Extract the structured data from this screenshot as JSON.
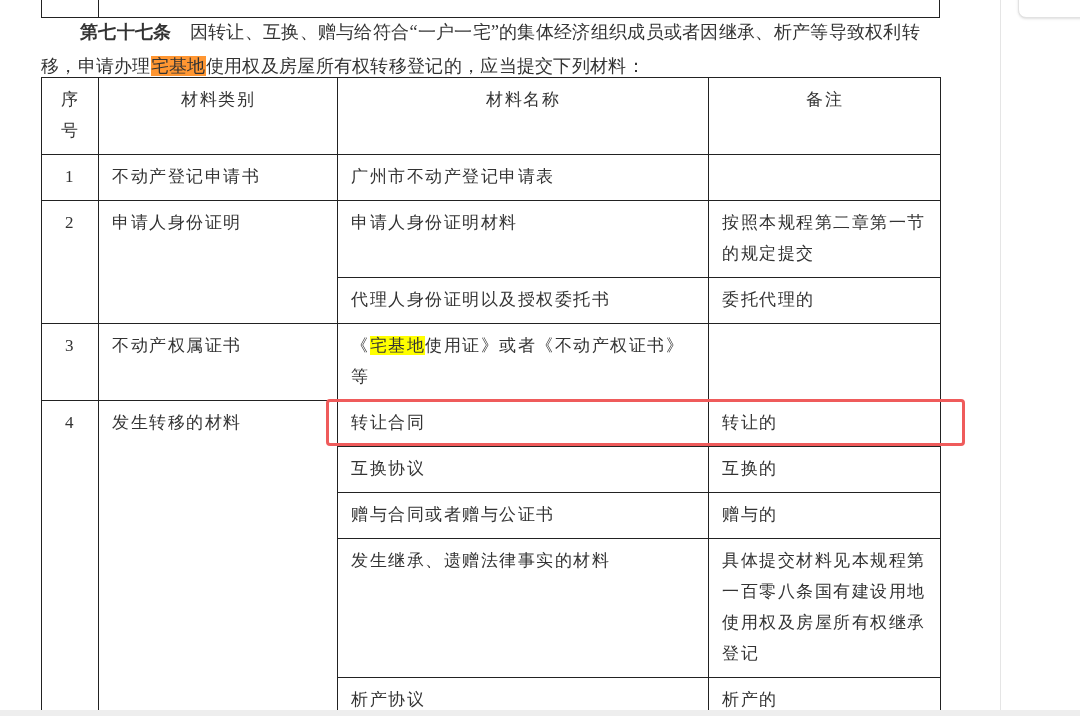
{
  "document": {
    "paragraph": [
      {
        "text": "**第七十七条**　因转让、互换、赠与给符合“一户一宅”的集体经济组织成员或者因继承、析产等导致权利转移，申请办理"
      },
      {
        "text": "宅基地",
        "color": "#ff9632"
      },
      {
        "text": "使用权及房屋所有权转移登记的，应当提交下列材料："
      }
    ]
  },
  "table": {
    "columns": [
      "序号",
      "材料类别",
      "材料名称",
      "备注"
    ],
    "groups": [
      {
        "number": "1",
        "category": "不动产登记申请书",
        "items": [
          {
            "name": [
              {
                "text": "广州市不动产登记申请表"
              }
            ],
            "highlighted": false
          }
        ]
      },
      {
        "number": "2",
        "category": "申请人身份证明",
        "items": [
          {
            "name": [
              {
                "text": "申请人身份证明材料"
              }
            ],
            "note": "按照本规程第二章第一节的规定提交",
            "highlighted": false
          },
          {
            "name": [
              {
                "text": "代理人身份证明以及授权委托书"
              }
            ],
            "note": "委托代理的",
            "highlighted": false
          }
        ]
      },
      {
        "number": "3",
        "category": "不动产权属证书",
        "items": [
          {
            "name": [
              {
                "text": "《"
              },
              {
                "text": "宅基地",
                "color": "#ffff00"
              },
              {
                "text": "使用证》或者《不动产权证书》等"
              }
            ],
            "highlighted": false
          }
        ]
      },
      {
        "number": "4",
        "category": "发生转移的材料",
        "items": [
          {
            "name": [
              {
                "text": "转让合同"
              }
            ],
            "note": "转让的",
            "highlighted": true
          },
          {
            "name": [
              {
                "text": "互换协议"
              }
            ],
            "note": "互换的",
            "highlighted": false
          },
          {
            "name": [
              {
                "text": "赠与合同或者赠与公证书"
              }
            ],
            "note": "赠与的",
            "highlighted": false
          },
          {
            "name": [
              {
                "text": "发生继承、遗赠法律事实的材料"
              }
            ],
            "note": "具体提交材料见本规程第一百零八条国有建设用地使用权及房屋所有权继承登记",
            "highlighted": false
          },
          {
            "name": [
              {
                "text": "析产协议"
              }
            ],
            "note": "析产的",
            "highlighted": false
          }
        ]
      }
    ]
  }
}
